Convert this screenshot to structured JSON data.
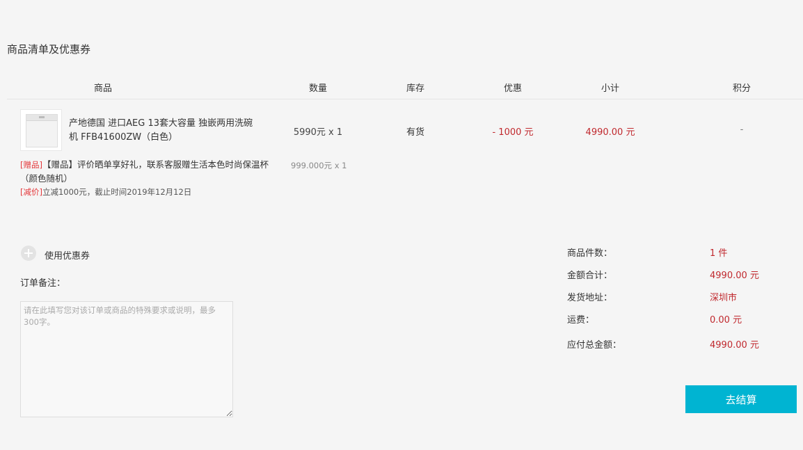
{
  "section_title": "商品清单及优惠券",
  "table_headers": {
    "product": "商品",
    "quantity": "数量",
    "stock": "库存",
    "discount": "优惠",
    "subtotal": "小计",
    "points": "积分"
  },
  "item": {
    "name": "产地德国 进口AEG 13套大容量 独嵌两用洗碗机 FFB41600ZW（白色）",
    "price_qty": "5990元 x 1",
    "stock": "有货",
    "discount": "- 1000 元",
    "subtotal": "4990.00 元",
    "points": "-",
    "thumbnail_icon": "dishwasher-image"
  },
  "gift": {
    "tag": "[赠品]",
    "text": "【赠品】评价晒单享好礼，联系客服赠生活本色时尚保温杯（颜色随机）",
    "qty": "999.000元 x 1"
  },
  "promotion": {
    "tag": "[减价]",
    "text": "立减1000元，截止时间2019年12月12日"
  },
  "coupon": {
    "label": "使用优惠券",
    "icon": "plus-circle-icon"
  },
  "remark": {
    "label": "订单备注：",
    "placeholder": "请在此填写您对该订单或商品的特殊要求或说明，最多300字。",
    "value": ""
  },
  "summary": {
    "count_label": "商品件数：",
    "count_value": "1 件",
    "amount_label": "金额合计：",
    "amount_value": "4990.00 元",
    "address_label": "发货地址：",
    "address_value": "深圳市",
    "shipping_label": "运费：",
    "shipping_value": "0.00 元",
    "total_label": "应付总金额：",
    "total_value": "4990.00 元"
  },
  "checkout_label": "去结算",
  "colors": {
    "accent": "#00b4d2",
    "price_red": "#c0282d",
    "tag_red": "#e4393c"
  }
}
